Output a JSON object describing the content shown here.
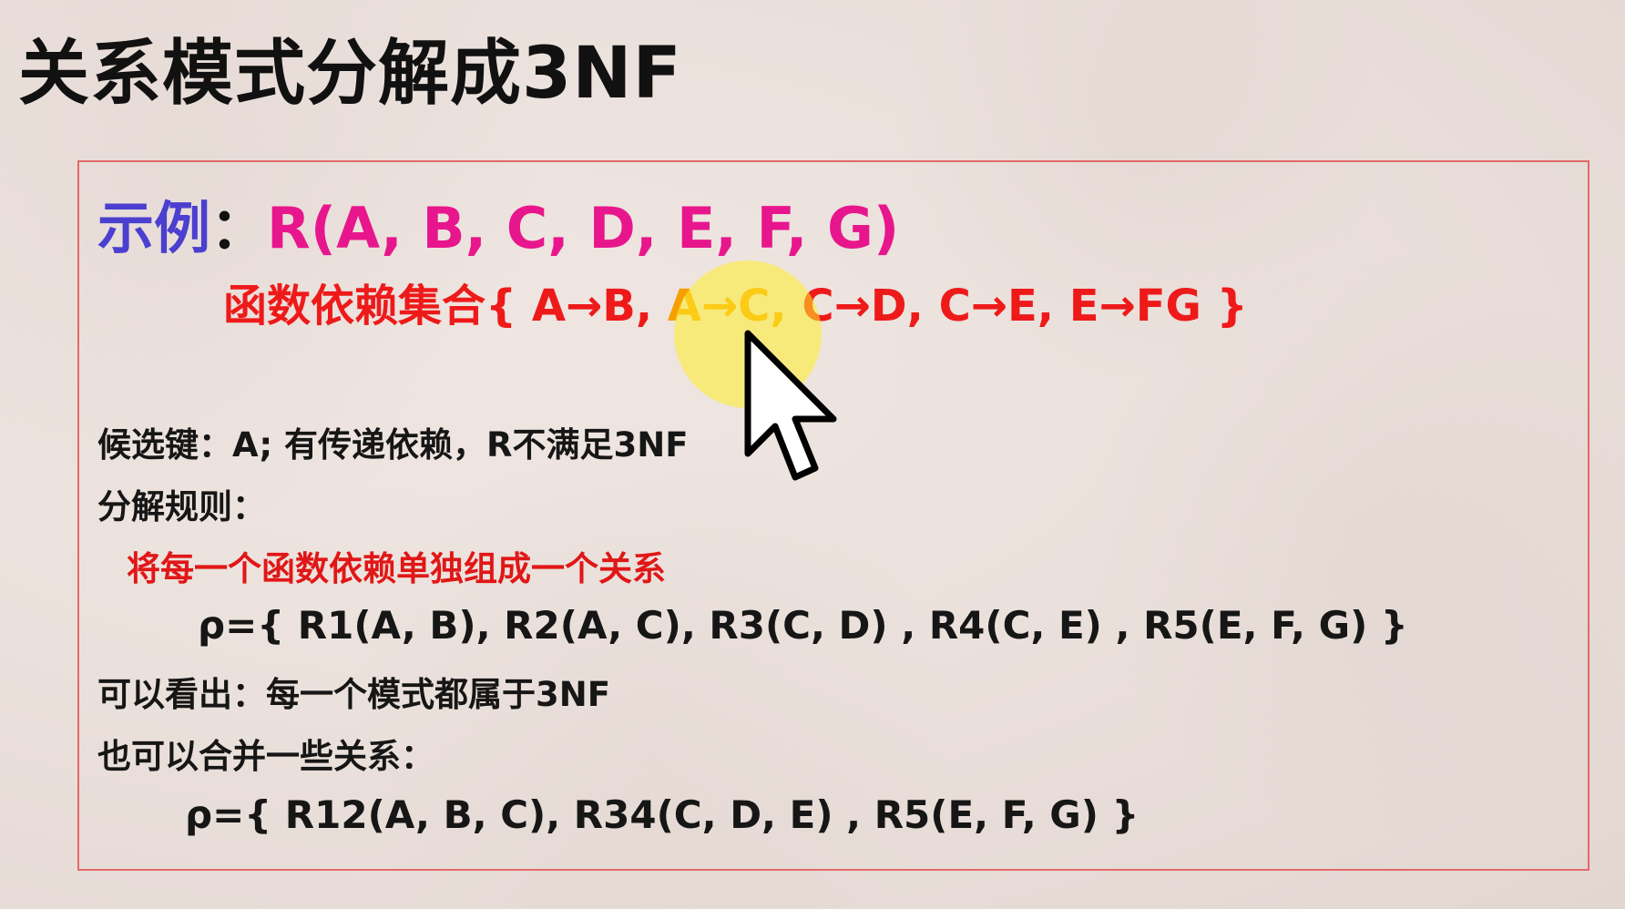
{
  "title": "关系模式分解成3NF",
  "example": {
    "label": "示例",
    "separator": "：",
    "relation": "R(A, B, C, D, E, F, G)"
  },
  "dependencies": {
    "prefix": "函数依赖集合{ A→B, ",
    "highlighted": "A→C,",
    "suffix": " C→D,  C→E,  E→FG }"
  },
  "candidate_key_line": "候选键：A;   有传递依赖，R不满足3NF",
  "rule_label": "分解规则：",
  "rule_text": "将每一个函数依赖单独组成一个关系",
  "decomposition_1": "ρ={ R1(A, B),   R2(A, C), R3(C, D) , R4(C, E) , R5(E, F, G) }",
  "conclusion": "可以看出：每一个模式都属于3NF",
  "merge_label": "也可以合并一些关系：",
  "decomposition_2": "ρ={ R12(A, B, C), R34(C, D, E) , R5(E, F, G) }",
  "icons": {
    "pointer": "mouse-pointer-icon",
    "highlight": "cursor-highlight"
  },
  "colors": {
    "title": "#111111",
    "example_label": "#4b3fd0",
    "relation": "#e8168c",
    "dependencies": "#ee1a1a",
    "dependency_highlight": "#f5a000",
    "rule": "#e01717",
    "box_border": "#e36a6a",
    "cursor_highlight": "#ffee28"
  }
}
